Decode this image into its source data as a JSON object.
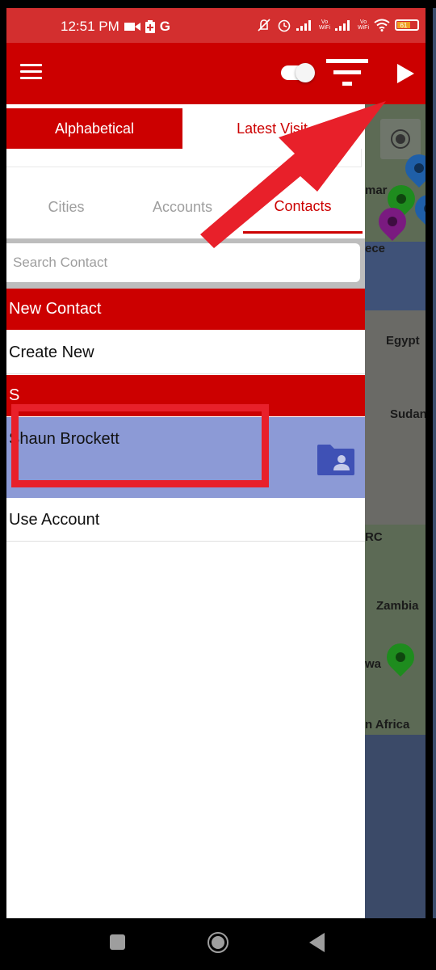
{
  "status_bar": {
    "time": "12:51 PM",
    "left_icons": [
      "video-camera-icon",
      "battery-saver-icon",
      "google-icon"
    ],
    "google_glyph": "G",
    "right_icons": [
      "mute-icon",
      "alarm-icon",
      "signal-1-icon",
      "vowifi-1-icon",
      "signal-2-icon",
      "vowifi-2-icon",
      "wifi-icon",
      "battery-icon"
    ],
    "vowifi_label": "Vo\nWiFi",
    "battery_level": "61"
  },
  "app_bar": {
    "menu_icon": "hamburger-menu-icon",
    "toggle_state": "on",
    "filter_icon": "filter-icon",
    "play_icon": "play-icon"
  },
  "sort": {
    "options": [
      {
        "label": "Alphabetical",
        "active": true
      },
      {
        "label": "Latest Visit",
        "active": false
      }
    ]
  },
  "tabs": [
    {
      "label": "Cities",
      "active": false
    },
    {
      "label": "Accounts",
      "active": false
    },
    {
      "label": "Contacts",
      "active": true
    }
  ],
  "search": {
    "placeholder": "Search Contact",
    "value": ""
  },
  "list": {
    "new_contact_header": "New Contact",
    "create_new": "Create New",
    "section_letter": "S",
    "contacts": [
      {
        "name": "Shaun Brockett",
        "icon": "contact-folder-icon",
        "selected": true
      }
    ],
    "use_account": "Use Account"
  },
  "map": {
    "labels": [
      "mar",
      "ece",
      "Egypt",
      "Sudan",
      "RC",
      "Zambia",
      "wa",
      "n Africa"
    ],
    "markers": [
      {
        "color": "#1e8c1e"
      },
      {
        "color": "#1f5fa8"
      },
      {
        "color": "#7a1a80"
      },
      {
        "color": "#1f5fa8"
      },
      {
        "color": "#1e8c1e"
      }
    ]
  },
  "colors": {
    "brand_red": "#cc0000",
    "status_red": "#d32f2f",
    "selected_row": "#8c9ad6",
    "contact_icon": "#3f51b5",
    "annotation_red": "#e8202a"
  },
  "nav_bar": {
    "buttons": [
      "recent-apps-button",
      "home-button",
      "back-button"
    ]
  }
}
